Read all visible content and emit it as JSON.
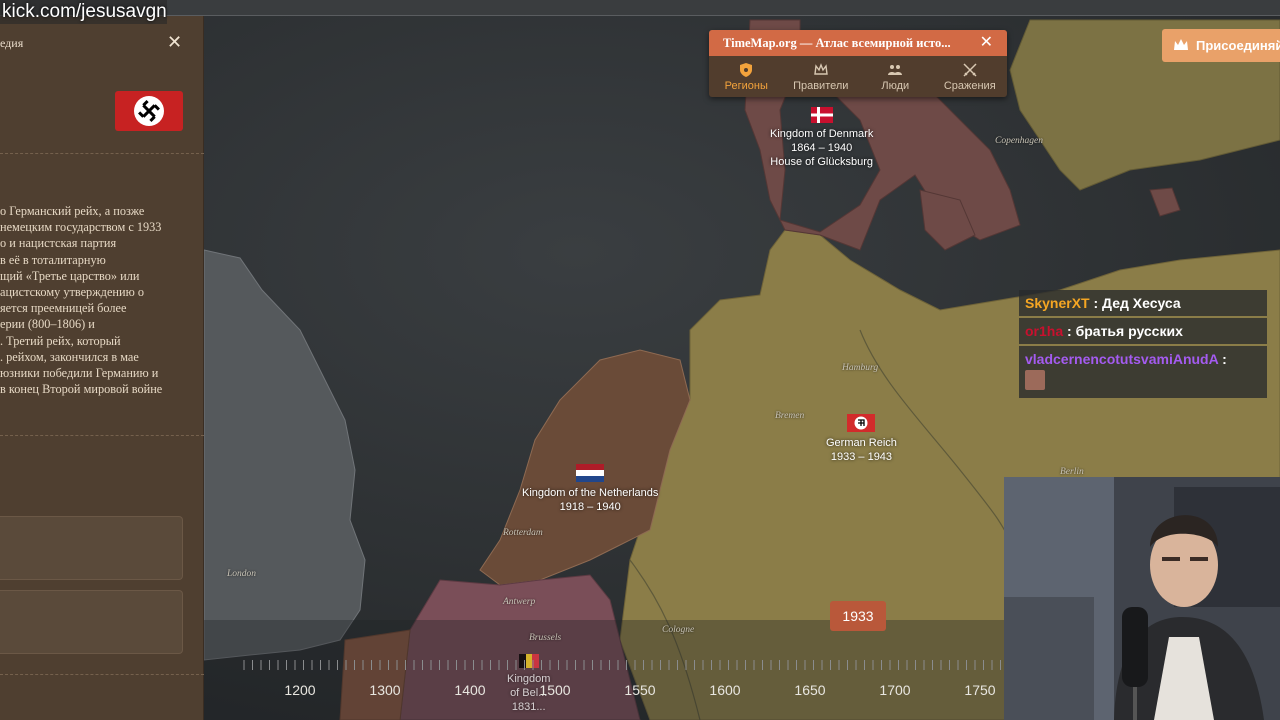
{
  "stream": {
    "url_overlay": "kick.com/jesusavgn"
  },
  "left_panel": {
    "title": "едия",
    "close_label": "✕",
    "flag_icon": "swastika-flag-icon",
    "description_lines": [
      "о Германский рейх, а позже",
      "немецким государством с 1933",
      "о и нацистская партия",
      "в её в тоталитарную",
      "щий «Третье царство» или",
      "ацистскому утверждению о",
      "яется преемницей более",
      "ерии (800–1806) и",
      ". Третий рейх, который",
      ". рейхом, закончился в мае",
      "юзники победили Германию и",
      "в конец Второй мировой войне"
    ]
  },
  "popup": {
    "title": "TimeMap.org — Атлас всемирной исто...",
    "close_label": "✕",
    "tabs": [
      {
        "label": "Регионы",
        "icon": "shield-icon",
        "active": true
      },
      {
        "label": "Правители",
        "icon": "crown-icon",
        "active": false
      },
      {
        "label": "Люди",
        "icon": "people-icon",
        "active": false
      },
      {
        "label": "Сражения",
        "icon": "crossed-swords-icon",
        "active": false
      }
    ]
  },
  "join_button": {
    "label": "Присоединяйтесь",
    "icon": "crown-icon"
  },
  "map": {
    "countries": {
      "denmark": {
        "name": "Kingdom of Denmark",
        "years": "1864 – 1940",
        "house": "House of Glücksburg"
      },
      "germany": {
        "name": "German Reich",
        "years": "1933 – 1943"
      },
      "netherlands": {
        "name": "Kingdom of the Netherlands",
        "years": "1918 – 1940"
      },
      "belgium": {
        "name": "Kingdom",
        "line2": "of Bel...",
        "years": "1831..."
      }
    },
    "cities": {
      "copenhagen": "Copenhagen",
      "hamburg": "Hamburg",
      "bremen": "Bremen",
      "berlin": "Berlin",
      "rotterdam": "Rotterdam",
      "antwerp": "Antwerp",
      "brussels": "Brussels",
      "cologne": "Cologne",
      "london": "London"
    },
    "current_year": "1933"
  },
  "timeline": {
    "labels": [
      "1200",
      "1300",
      "1400",
      "1500",
      "1550",
      "1600",
      "1650",
      "1700",
      "1750"
    ]
  },
  "chat": [
    {
      "user": "SkynerXT",
      "user_color": "#f5a623",
      "text": "Дед Хесуса"
    },
    {
      "user": "or1ha",
      "user_color": "#c8102e",
      "text": "братья русских"
    },
    {
      "user": "vladcernencotutsvamiAnudA",
      "user_color": "#a45bf0",
      "text": ":"
    }
  ],
  "colors": {
    "popup_header": "#d26a45",
    "active_tab": "#f3a33c",
    "germany_fill": "#8b7d48",
    "netherlands_fill": "#6a4b38",
    "denmark_fill": "#6e4a47",
    "belgium_fill": "#7a4e58",
    "sea": "#2b2e30"
  }
}
